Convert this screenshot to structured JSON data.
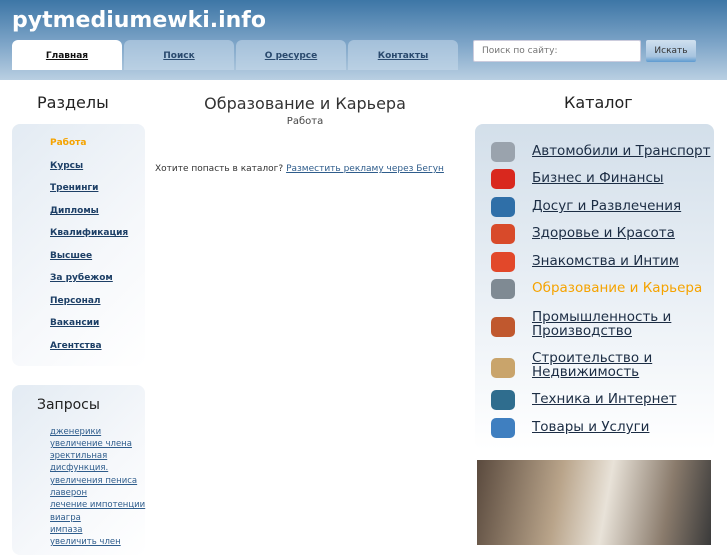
{
  "site": {
    "title": "pytmediumewki.info"
  },
  "tabs": [
    {
      "label": "Главная"
    },
    {
      "label": "Поиск"
    },
    {
      "label": "О ресурсе"
    },
    {
      "label": "Контакты"
    }
  ],
  "search": {
    "placeholder": "Поиск по сайту:",
    "button": "Искать"
  },
  "sections": {
    "title": "Разделы",
    "items": [
      "Работа",
      "Курсы",
      "Тренинги",
      "Дипломы",
      "Квалификация",
      "Высшее",
      "За рубежом",
      "Персонал",
      "Вакансии",
      "Агентства"
    ]
  },
  "queries": {
    "title": "Запросы",
    "items": [
      "дженерики",
      "увеличение члена",
      "эректильная",
      "дисфункция.",
      "увеличения пениса",
      "лаверон",
      "лечение импотенции",
      "виагра",
      "импаза",
      "увеличить член"
    ]
  },
  "main": {
    "title": "Образование и Карьера",
    "subtitle": "Работа",
    "prompt": "Хотите попасть в каталог?",
    "link": "Разместить рекламу через Бегун"
  },
  "catalog": {
    "title": "Каталог",
    "items": [
      {
        "label": "Автомобили и Транспорт",
        "icon": "car-icon",
        "color": "#9aa3ad"
      },
      {
        "label": "Бизнес и Финансы",
        "icon": "pie-chart-icon",
        "color": "#d9281e"
      },
      {
        "label": "Досуг и Развлечения",
        "icon": "bowling-icon",
        "color": "#2f6fa8"
      },
      {
        "label": "Здоровье и Красота",
        "icon": "cosmetics-icon",
        "color": "#d84a2a"
      },
      {
        "label": "Знакомства и Интим",
        "icon": "heart-icon",
        "color": "#e2482a"
      },
      {
        "label": "Образование и Карьера",
        "icon": "briefcase-icon",
        "color": "#7f8a93"
      },
      {
        "label": "Промышленность и Производство",
        "icon": "factory-icon",
        "color": "#c0582e"
      },
      {
        "label": "Строительство и Недвижимость",
        "icon": "construction-icon",
        "color": "#c9a46b"
      },
      {
        "label": "Техника и Интернет",
        "icon": "monitor-icon",
        "color": "#2f6d8e"
      },
      {
        "label": "Товары и Услуги",
        "icon": "shopping-bag-icon",
        "color": "#3f7fc0"
      }
    ]
  }
}
